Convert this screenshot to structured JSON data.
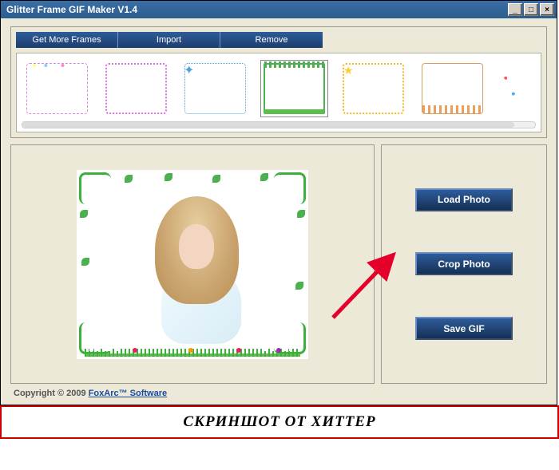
{
  "window": {
    "title": "Glitter Frame GIF Maker V1.4"
  },
  "toolbar": {
    "get_frames": "Get More Frames",
    "import": "Import",
    "remove": "Remove"
  },
  "thumbnails": {
    "selected_index": 3,
    "items": [
      {
        "name": "frame-pink-balloons"
      },
      {
        "name": "frame-pink-dotted"
      },
      {
        "name": "frame-blue-stars"
      },
      {
        "name": "frame-green-vine"
      },
      {
        "name": "frame-yellow-sun"
      },
      {
        "name": "frame-brown-fence"
      },
      {
        "name": "frame-confetti"
      }
    ]
  },
  "actions": {
    "load": "Load Photo",
    "crop": "Crop Photo",
    "save": "Save GIF"
  },
  "footer": {
    "copyright": "Copyright © 2009 ",
    "link_text": "FoxArc™ Software"
  },
  "banner": {
    "text": "СКРИНШОТ ОТ ХИТТЕР"
  },
  "arrow": {
    "color": "#e4002b",
    "points_to": "crop-photo-button"
  }
}
